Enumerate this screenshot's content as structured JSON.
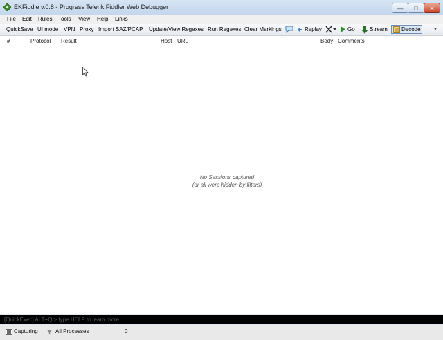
{
  "window": {
    "title": "EKFiddle v.0.8 - Progress Telerik Fiddler Web Debugger",
    "controls": {
      "minimize": "—",
      "maximize": "□",
      "close": "✕"
    }
  },
  "menu": [
    "File",
    "Edit",
    "Rules",
    "Tools",
    "View",
    "Help",
    "Links"
  ],
  "toolbar": {
    "quicksave": "QuickSave",
    "ui_mode": "UI mode",
    "vpn": "VPN",
    "proxy": "Proxy",
    "import": "Import SAZ/PCAP",
    "update_regexes": "Update/View Regexes",
    "run_regexes": "Run Regexes",
    "clear_markings": "Clear Markings",
    "replay": "Replay",
    "go": "Go",
    "stream": "Stream",
    "decode": "Decode"
  },
  "columns": [
    "#",
    "Protocol",
    "Result",
    "Host",
    "URL",
    "Body",
    "Comments"
  ],
  "sessions": {
    "empty_line1": "No Sessions captured",
    "empty_line2": "(or all were hidden by filters)"
  },
  "quickexec": {
    "placeholder": "[QuickExec] ALT+Q > type HELP to learn more"
  },
  "status": {
    "capturing": "Capturing",
    "processes": "All Processes",
    "count": "0"
  },
  "colors": {
    "titlebar": "#c9daee",
    "quickexec_bg": "#000000",
    "accent": "#2a8a2a"
  }
}
